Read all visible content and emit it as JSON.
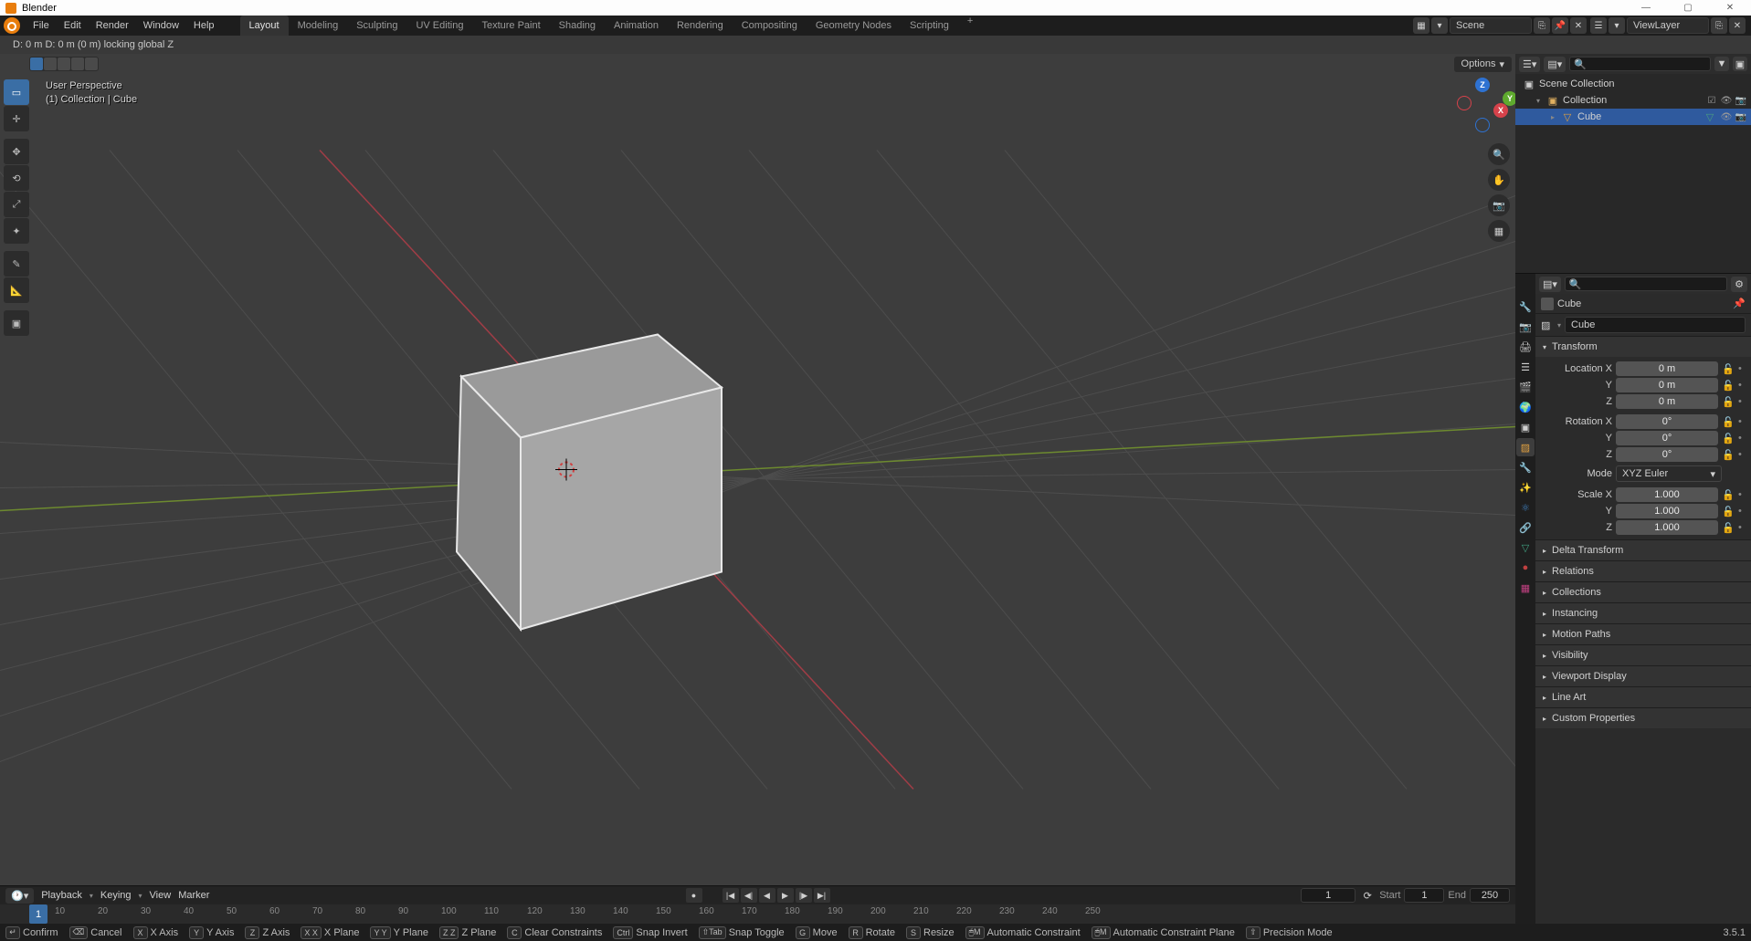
{
  "app": {
    "title": "Blender"
  },
  "menus": [
    "File",
    "Edit",
    "Render",
    "Window",
    "Help"
  ],
  "workspace_tabs": [
    "Layout",
    "Modeling",
    "Sculpting",
    "UV Editing",
    "Texture Paint",
    "Shading",
    "Animation",
    "Rendering",
    "Compositing",
    "Geometry Nodes",
    "Scripting"
  ],
  "active_tab": "Layout",
  "scene_name": "Scene",
  "viewlayer_name": "ViewLayer",
  "header_status": "D: 0 m   D: 0 m (0 m) locking global Z",
  "viewport": {
    "info1": "User Perspective",
    "info2": "(1) Collection | Cube",
    "options_label": "Options"
  },
  "outliner": {
    "root": "Scene Collection",
    "collection": "Collection",
    "object": "Cube"
  },
  "properties": {
    "breadcrumb": "Cube",
    "name_field": "Cube",
    "transform_label": "Transform",
    "loc": {
      "label": "Location X",
      "y": "Y",
      "z": "Z",
      "vx": "0 m",
      "vy": "0 m",
      "vz": "0 m"
    },
    "rot": {
      "label": "Rotation X",
      "y": "Y",
      "z": "Z",
      "vx": "0°",
      "vy": "0°",
      "vz": "0°"
    },
    "mode_label": "Mode",
    "mode_value": "XYZ Euler",
    "scale": {
      "label": "Scale X",
      "y": "Y",
      "z": "Z",
      "vx": "1.000",
      "vy": "1.000",
      "vz": "1.000"
    },
    "panels": [
      "Delta Transform",
      "Relations",
      "Collections",
      "Instancing",
      "Motion Paths",
      "Visibility",
      "Viewport Display",
      "Line Art",
      "Custom Properties"
    ]
  },
  "timeline": {
    "menus": [
      "Playback",
      "Keying",
      "View",
      "Marker"
    ],
    "current": "1",
    "start_label": "Start",
    "start": "1",
    "end_label": "End",
    "end": "250",
    "ticks": [
      10,
      20,
      30,
      40,
      50,
      60,
      70,
      80,
      90,
      100,
      110,
      120,
      130,
      140,
      150,
      160,
      170,
      180,
      190,
      200,
      210,
      220,
      230,
      240,
      250
    ]
  },
  "statusbar": {
    "items": [
      {
        "key": "↵",
        "label": "Confirm"
      },
      {
        "key": "⌫",
        "label": "Cancel"
      },
      {
        "key": "X",
        "label": "X Axis"
      },
      {
        "key": "Y",
        "label": "Y Axis"
      },
      {
        "key": "Z",
        "label": "Z Axis"
      },
      {
        "key": "X X",
        "label": "X Plane"
      },
      {
        "key": "Y Y",
        "label": "Y Plane"
      },
      {
        "key": "Z Z",
        "label": "Z Plane"
      },
      {
        "key": "C",
        "label": "Clear Constraints"
      },
      {
        "key": "Ctrl",
        "label": "Snap Invert"
      },
      {
        "key": "⇧Tab",
        "label": "Snap Toggle"
      },
      {
        "key": "G",
        "label": "Move"
      },
      {
        "key": "R",
        "label": "Rotate"
      },
      {
        "key": "S",
        "label": "Resize"
      },
      {
        "key": "🖱M",
        "label": "Automatic Constraint"
      },
      {
        "key": "🖱M",
        "label": "Automatic Constraint Plane"
      },
      {
        "key": "⇧",
        "label": "Precision Mode"
      }
    ],
    "version": "3.5.1"
  }
}
